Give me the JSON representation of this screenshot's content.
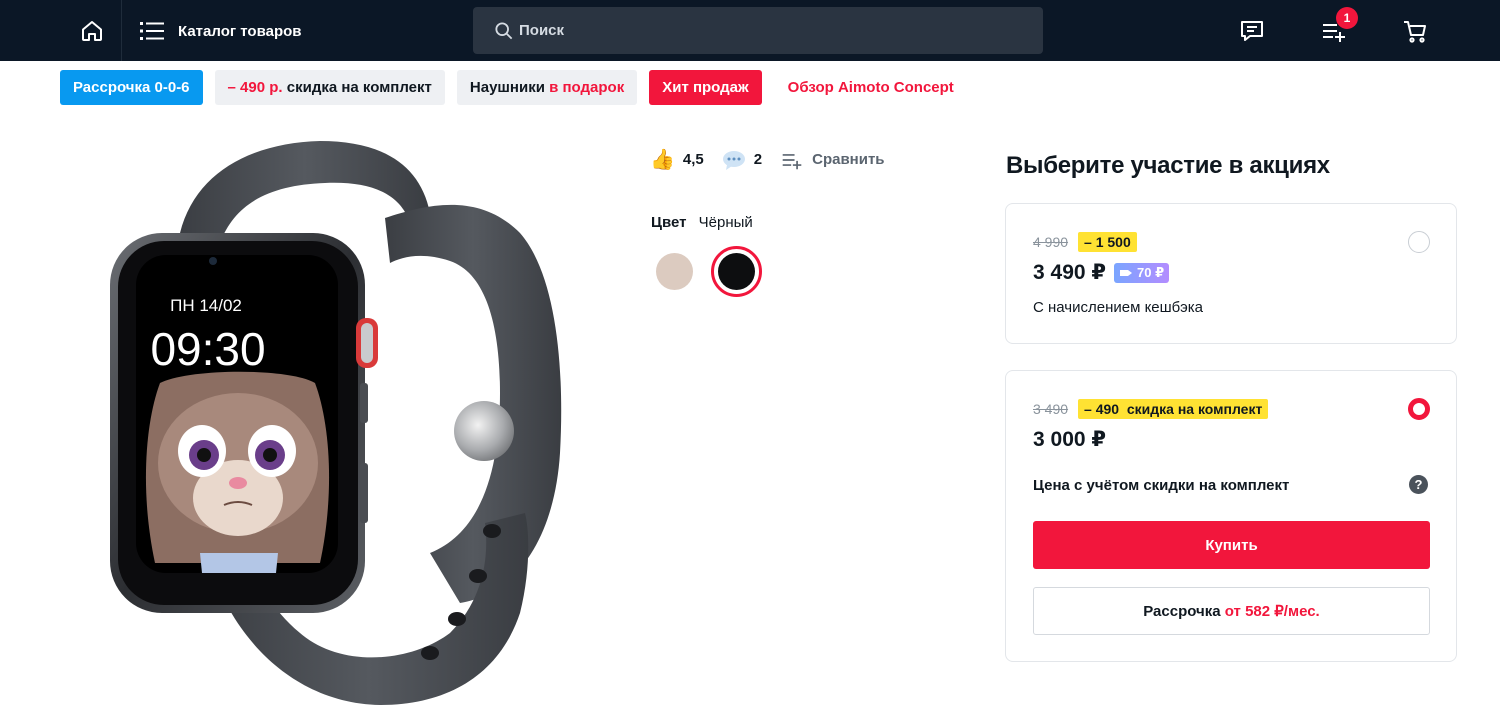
{
  "header": {
    "catalog_label": "Каталог товаров",
    "search_placeholder": "Поиск",
    "compare_badge": "1"
  },
  "chips": [
    {
      "text": "Рассрочка 0-0-6"
    },
    {
      "prefix": "– 490 р.",
      "suffix": " скидка на комплект"
    },
    {
      "prefix": "Наушники ",
      "suffix": "в подарок"
    },
    {
      "text": "Хит продаж"
    },
    {
      "text": "Обзор Aimoto Concept"
    }
  ],
  "product": {
    "watch_day": "ПН 14/02",
    "watch_time": "09:30",
    "rating": "4,5",
    "comments": "2",
    "compare_label": "Сравнить",
    "color_label": "Цвет",
    "color_value": "Чёрный",
    "colors": [
      "#dccbc0",
      "#0d0e10"
    ]
  },
  "promo": {
    "title": "Выберите участие в акциях",
    "option1": {
      "old_price": "4 990",
      "discount": "– 1 500",
      "price": "3 490 ₽",
      "cashback": "70 ₽",
      "note": "С начислением кешбэка",
      "selected": false
    },
    "option2": {
      "old_price": "3 490",
      "discount": "– 490  скидка на комплект",
      "price": "3 000 ₽",
      "note": "Цена с учётом скидки на комплект",
      "help": "?",
      "buy_label": "Купить",
      "credit_label": "Рассрочка ",
      "credit_amount": "от 582 ₽/мес.",
      "selected": true
    }
  },
  "colors": {
    "accent": "#f2163c",
    "header_bg": "#0b1726",
    "chip_blue": "#0899f0",
    "discount_yellow": "#ffe233"
  }
}
